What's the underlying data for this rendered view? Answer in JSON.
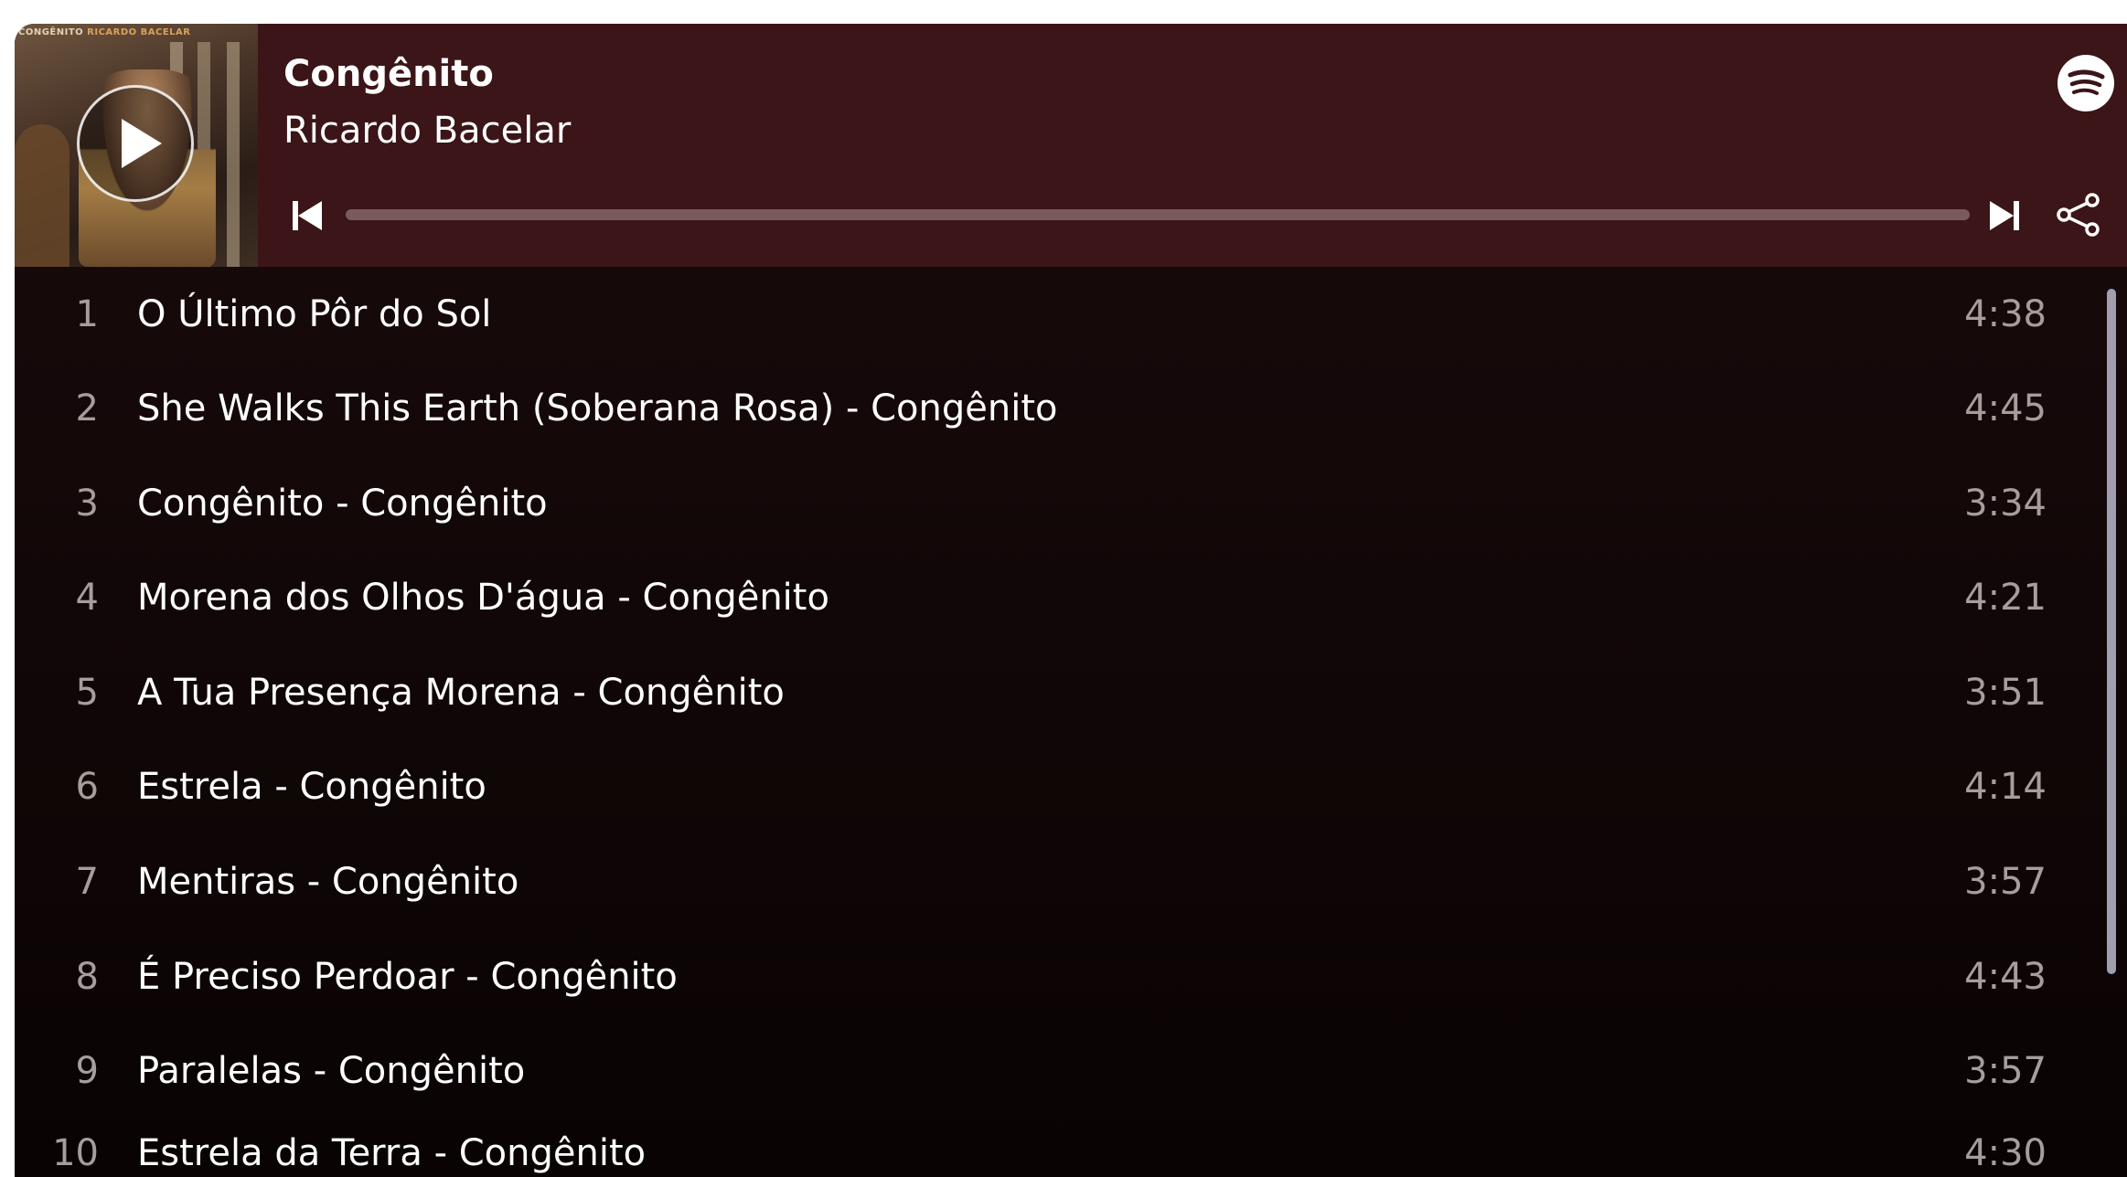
{
  "album": {
    "title": "Congênito",
    "artist": "Ricardo Bacelar",
    "cover_text_left": "CONGÊNITO",
    "cover_text_right": "RICARDO BACELAR"
  },
  "player": {
    "progress_fraction": 0,
    "play_icon": "play-icon",
    "prev_icon": "skip-previous-icon",
    "next_icon": "skip-next-icon",
    "share_icon": "share-icon",
    "brand_icon": "spotify-logo-icon"
  },
  "colors": {
    "header_bg": "#3b1517",
    "list_bg": "#120708",
    "track_text": "#ffffff",
    "muted_text": "#a79d9d",
    "progress_track": "#7a5b5c",
    "scrollbar": "#9f9fb1"
  },
  "tracks": [
    {
      "number": "1",
      "name": "O Último Pôr do Sol",
      "duration": "4:38"
    },
    {
      "number": "2",
      "name": "She Walks This Earth (Soberana Rosa) - Congênito",
      "duration": "4:45"
    },
    {
      "number": "3",
      "name": "Congênito - Congênito",
      "duration": "3:34"
    },
    {
      "number": "4",
      "name": "Morena dos Olhos D'água - Congênito",
      "duration": "4:21"
    },
    {
      "number": "5",
      "name": "A Tua Presença Morena - Congênito",
      "duration": "3:51"
    },
    {
      "number": "6",
      "name": "Estrela - Congênito",
      "duration": "4:14"
    },
    {
      "number": "7",
      "name": "Mentiras - Congênito",
      "duration": "3:57"
    },
    {
      "number": "8",
      "name": "É Preciso Perdoar - Congênito",
      "duration": "4:43"
    },
    {
      "number": "9",
      "name": "Paralelas - Congênito",
      "duration": "3:57"
    },
    {
      "number": "10",
      "name": "Estrela da Terra - Congênito",
      "duration": "4:30"
    }
  ]
}
